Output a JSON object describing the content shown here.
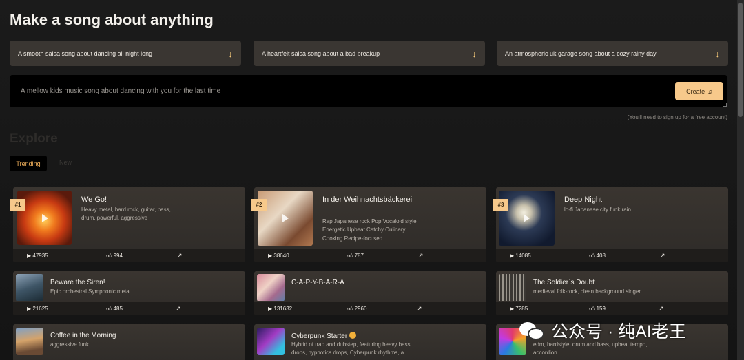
{
  "header": {
    "title": "Make a song about anything"
  },
  "suggestions": [
    {
      "text": "A smooth salsa song about dancing all night long"
    },
    {
      "text": "A heartfelt salsa song about a bad breakup"
    },
    {
      "text": "An atmospheric uk garage song about a cozy rainy day"
    }
  ],
  "prompt_input": {
    "value": "A mellow kids music song about dancing with you for the last time",
    "create_label": "Create"
  },
  "signup_note": "(You'll need to sign up for a free account)",
  "explore": {
    "heading": "Explore",
    "tabs": [
      "Trending",
      "New"
    ]
  },
  "top_songs": [
    {
      "rank": "#1",
      "title": "We Go!",
      "desc": "Heavy metal, hard rock, guitar, bass, drum, powerful, aggressive",
      "plays": "47935",
      "likes": "994"
    },
    {
      "rank": "#2",
      "title": "In der Weihnachtsbäckerei",
      "desc": "Rap Japanese rock Pop Vocaloid style Energetic Upbeat Catchy Culinary Cooking Recipe-focused",
      "plays": "38640",
      "likes": "787"
    },
    {
      "rank": "#3",
      "title": "Deep Night",
      "desc": "lo-fi Japanese city funk rain",
      "plays": "14085",
      "likes": "408"
    }
  ],
  "songs_row2": [
    {
      "title": "Beware the Siren!",
      "desc": "Epic orchestral Symphonic metal",
      "plays": "21625",
      "likes": "485"
    },
    {
      "title": "C-A-P-Y-B-A-R-A",
      "desc": "",
      "plays": "131632",
      "likes": "2960"
    },
    {
      "title": "The Soldier`s Doubt",
      "desc": "medieval folk-rock, clean background singer",
      "plays": "7285",
      "likes": "159"
    }
  ],
  "songs_row3": [
    {
      "title": "Coffee in the Morning",
      "desc": "aggressive funk"
    },
    {
      "title": "Cyberpunk Starter",
      "desc": "Hybrid of trap and dubstep, featuring heavy bass drops, hypnotics drops, Cyberpunk rhythms, a..."
    },
    {
      "title": "",
      "desc": "edm, hardstyle, drum and bass, upbeat tempo, accordion"
    }
  ],
  "icons": {
    "suggest": "arrow-down-icon",
    "create": "music-note-icon",
    "play": "play-icon",
    "like": "thumbs-up-icon",
    "share": "share-icon",
    "more": "more-icon"
  },
  "colors": {
    "accent": "#f7c98b",
    "trending": "#f2b15c"
  },
  "watermark": "公众号 · 纯AI老王"
}
